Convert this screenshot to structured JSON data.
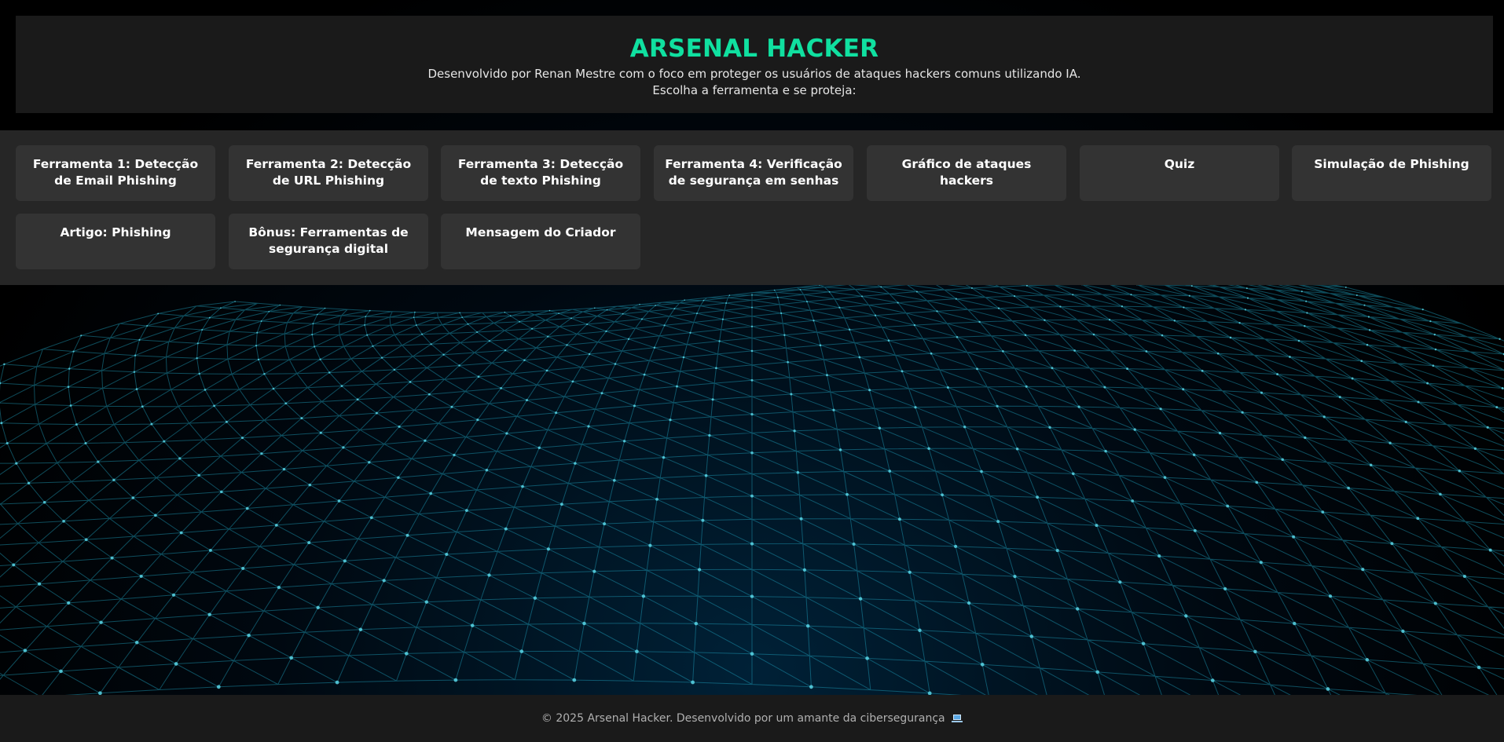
{
  "header": {
    "title": "ARSENAL HACKER",
    "line1": "Desenvolvido por Renan Mestre com o foco em proteger os usuários de ataques hackers comuns utilizando IA.",
    "line2": "Escolha a ferramenta e se proteja:"
  },
  "tools": [
    {
      "label": "Ferramenta 1: Detecção de Email Phishing"
    },
    {
      "label": "Ferramenta 2: Detecção de URL Phishing"
    },
    {
      "label": "Ferramenta 3: Detecção de texto Phishing"
    },
    {
      "label": "Ferramenta 4: Verificação de segurança em senhas"
    },
    {
      "label": "Gráfico de ataques hackers"
    },
    {
      "label": "Quiz"
    },
    {
      "label": "Simulação de Phishing"
    },
    {
      "label": "Artigo: Phishing"
    },
    {
      "label": "Bônus: Ferramentas de segurança digital"
    },
    {
      "label": "Mensagem do Criador"
    }
  ],
  "footer": {
    "text": "© 2025 Arsenal Hacker. Desenvolvido por um amante da cibersegurança",
    "icon": "laptop-icon"
  },
  "colors": {
    "accent": "#10e0a0",
    "header_bg": "#1a1a1a",
    "nav_bg": "#262626",
    "button_bg": "#333333",
    "mesh": "#1fa7c4"
  }
}
